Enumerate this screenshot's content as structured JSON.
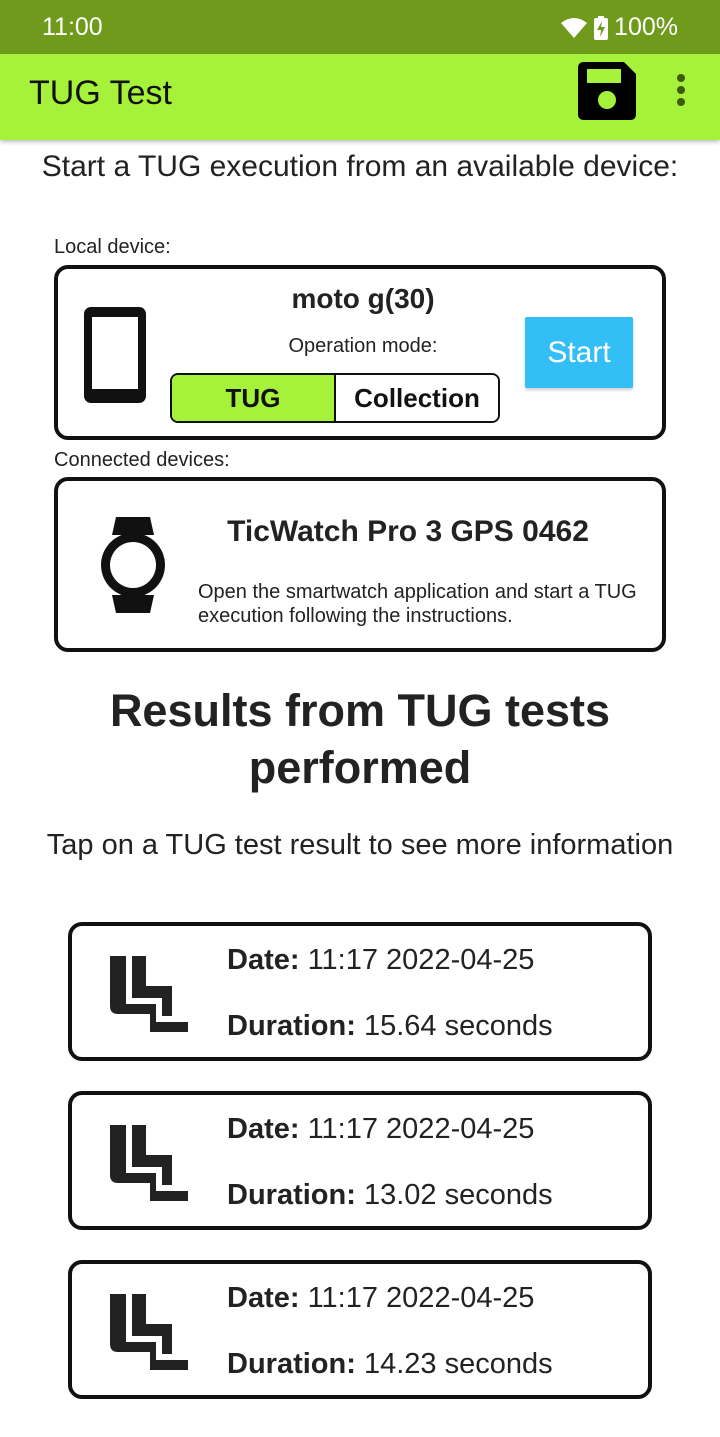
{
  "status_bar": {
    "time": "11:00",
    "battery": "100%",
    "icons": [
      "wifi-icon",
      "battery-charging-icon"
    ]
  },
  "app_bar": {
    "title": "TUG Test",
    "icons": [
      "save-icon",
      "more-vert-icon"
    ]
  },
  "intro_text": "Start a TUG execution from an available device:",
  "local": {
    "label": "Local device:",
    "device_name": "moto g(30)",
    "operation_mode_label": "Operation mode:",
    "modes": [
      "TUG",
      "Collection"
    ],
    "selected_mode": "TUG",
    "start_label": "Start",
    "icon": "phone-icon"
  },
  "connected": {
    "label": "Connected devices:",
    "device_name": "TicWatch Pro 3 GPS 0462",
    "info": "Open the smartwatch application and start a TUG execution following the instructions.",
    "icon": "smartwatch-icon"
  },
  "results": {
    "title": "Results from TUG tests performed",
    "subtitle": "Tap on a TUG test result to see more information",
    "date_label": "Date:",
    "duration_label": "Duration:",
    "items": [
      {
        "date": "11:17 2022-04-25",
        "duration": "15.64 seconds"
      },
      {
        "date": "11:17 2022-04-25",
        "duration": "13.02 seconds"
      },
      {
        "date": "11:17 2022-04-25",
        "duration": "14.23 seconds"
      }
    ],
    "icon": "chair-icon"
  },
  "colors": {
    "status_bar": "#6f9a1c",
    "app_bar": "#a6f23a",
    "start_button": "#33bff6",
    "selected_mode": "#a6f23a"
  }
}
